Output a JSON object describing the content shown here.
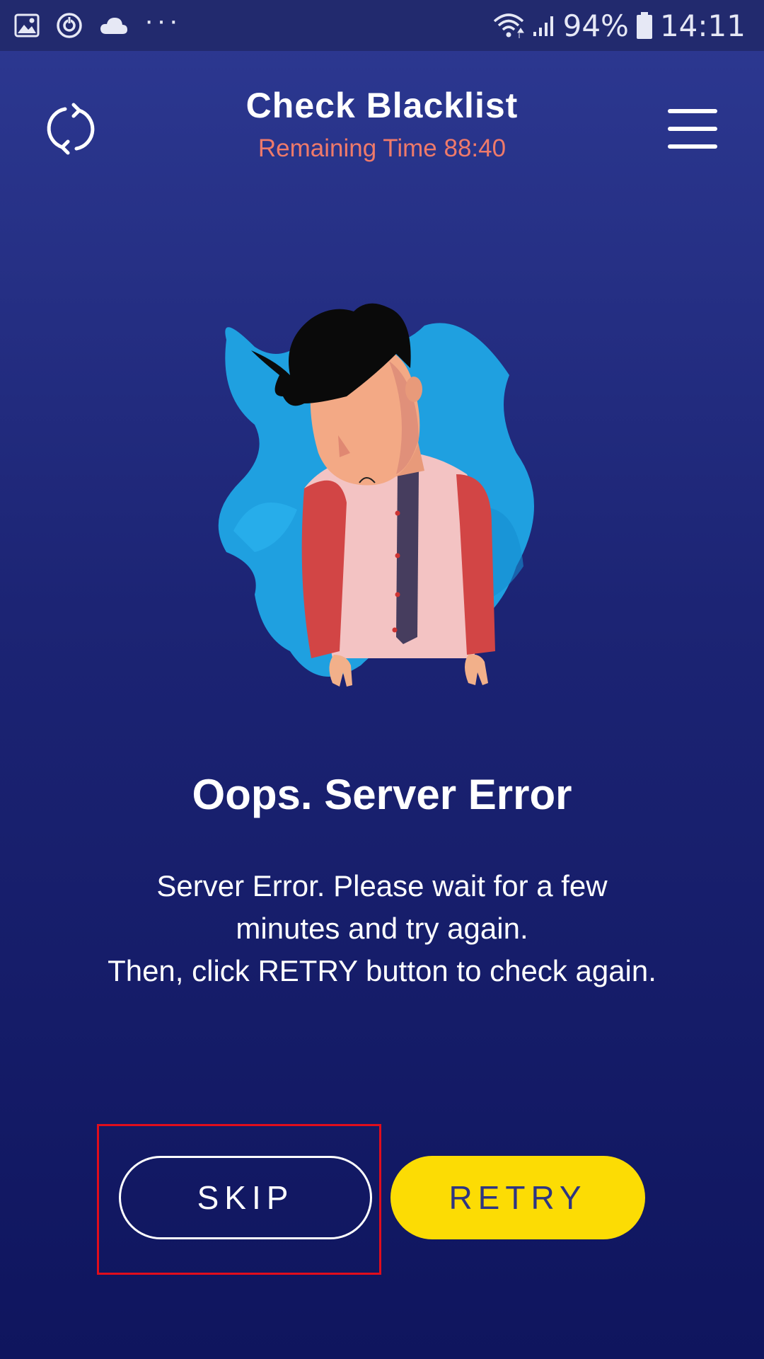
{
  "status_bar": {
    "battery_percent": "94%",
    "time": "14:11",
    "overflow_label": "···",
    "icons": [
      "gallery-icon",
      "sync-icon",
      "cloud-icon",
      "wifi-icon",
      "signal-icon",
      "battery-icon"
    ]
  },
  "header": {
    "title": "Check Blacklist",
    "subtitle": "Remaining Time 88:40",
    "refresh_icon": "refresh-icon",
    "menu_icon": "hamburger-menu-icon"
  },
  "error": {
    "title": "Oops. Server Error",
    "line1": "Server Error. Please wait for a few minutes and try again.",
    "line2": "Then, click RETRY button to check again."
  },
  "buttons": {
    "skip_label": "SKIP",
    "retry_label": "RETRY"
  },
  "colors": {
    "background_top": "#2d3992",
    "background_bottom": "#0f155e",
    "accent_subtitle": "#ef7a6a",
    "retry_button": "#fcdc04",
    "retry_text": "#2e3582",
    "highlight": "#e00d1c"
  }
}
